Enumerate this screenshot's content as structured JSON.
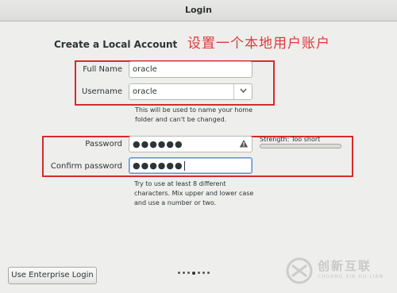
{
  "window": {
    "title": "Login"
  },
  "page": {
    "heading": "Create a Local Account",
    "annotation": "设置一个本地用户账户"
  },
  "form": {
    "full_name": {
      "label": "Full Name",
      "value": "oracle"
    },
    "username": {
      "label": "Username",
      "value": "oracle",
      "hint_line1": "This will be used to name your home",
      "hint_line2": "folder and can't be changed."
    },
    "password": {
      "label": "Password",
      "value": "●●●●●●"
    },
    "confirm_password": {
      "label": "Confirm password",
      "value": "●●●●●●"
    },
    "strength": {
      "label": "Strength: Too short",
      "level": 0
    },
    "password_hint": {
      "line1": "Try to use at least 8 different",
      "line2": "characters. Mix upper and lower case",
      "line3": "and use a number or two."
    }
  },
  "footer": {
    "enterprise_login_label": "Use Enterprise Login",
    "page_dots": {
      "count": 7,
      "active_index": 3
    }
  },
  "watermark": {
    "text": "创新互联",
    "subtext": "CHUANG XIN HU LIAN"
  },
  "colors": {
    "annotation_red": "#d62b2b",
    "focus_blue": "#5f8dd3"
  }
}
